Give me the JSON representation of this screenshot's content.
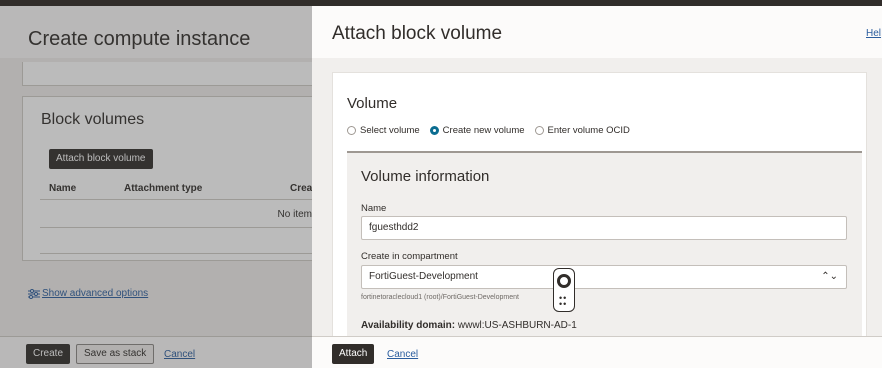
{
  "background_page": {
    "title": "Create compute instance",
    "block_volumes_title": "Block volumes",
    "attach_button": "Attach block volume",
    "table": {
      "col_name": "Name",
      "col_attachment_type": "Attachment type",
      "col_created": "Crea",
      "empty_text": "No items"
    },
    "advanced_link": "Show advanced options",
    "footer": {
      "create": "Create",
      "save_stack": "Save as stack",
      "cancel": "Cancel"
    }
  },
  "panel": {
    "title": "Attach block volume",
    "help": "Hel",
    "volume": {
      "title": "Volume",
      "radios": [
        {
          "label": "Select volume",
          "selected": false
        },
        {
          "label": "Create new volume",
          "selected": true
        },
        {
          "label": "Enter volume OCID",
          "selected": false
        }
      ]
    },
    "info": {
      "title": "Volume information",
      "name_label": "Name",
      "name_value": "fguesthdd2",
      "compartment_label": "Create in compartment",
      "compartment_value": "FortiGuest-Development",
      "compartment_path": "fortinetoraclecloud1 (root)/FortiGuest-Development",
      "availability_label": "Availability domain:",
      "availability_value": "wwwl:US-ASHBURN-AD-1"
    },
    "footer": {
      "attach": "Attach",
      "cancel": "Cancel"
    }
  },
  "colors": {
    "accent": "#0b6d91",
    "link": "#2a5d9e",
    "dark_button": "#312d2a"
  }
}
